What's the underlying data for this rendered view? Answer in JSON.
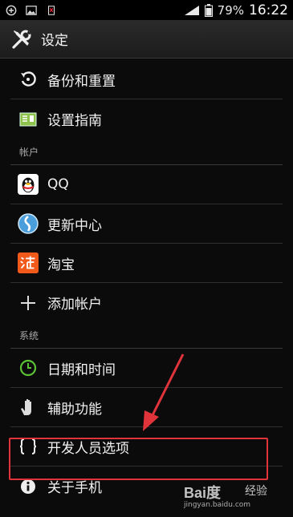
{
  "status_bar": {
    "battery": "79%",
    "time": "16:22"
  },
  "title_bar": {
    "title": "设定",
    "icon": "wrench-screwdriver-icon"
  },
  "list": {
    "top_items": [
      {
        "label": "备份和重置",
        "icon": "backup-restore-icon"
      },
      {
        "label": "设置指南",
        "icon": "setup-guide-icon"
      }
    ],
    "accounts_header": "帐户",
    "accounts": [
      {
        "label": "QQ",
        "icon": "qq-penguin-icon"
      },
      {
        "label": "更新中心",
        "icon": "update-center-icon"
      },
      {
        "label": "淘宝",
        "icon": "taobao-icon"
      },
      {
        "label": "添加帐户",
        "icon": "plus-icon"
      }
    ],
    "system_header": "系统",
    "system": [
      {
        "label": "日期和时间",
        "icon": "clock-icon"
      },
      {
        "label": "辅助功能",
        "icon": "hand-icon"
      },
      {
        "label": "开发人员选项",
        "icon": "braces-icon"
      },
      {
        "label": "关于手机",
        "icon": "info-icon"
      }
    ]
  },
  "annotation": {
    "color": "#e0343a"
  },
  "watermark": {
    "brand": "Bai度",
    "jingyan": "经验",
    "url": "jingyan.baidu.com"
  }
}
